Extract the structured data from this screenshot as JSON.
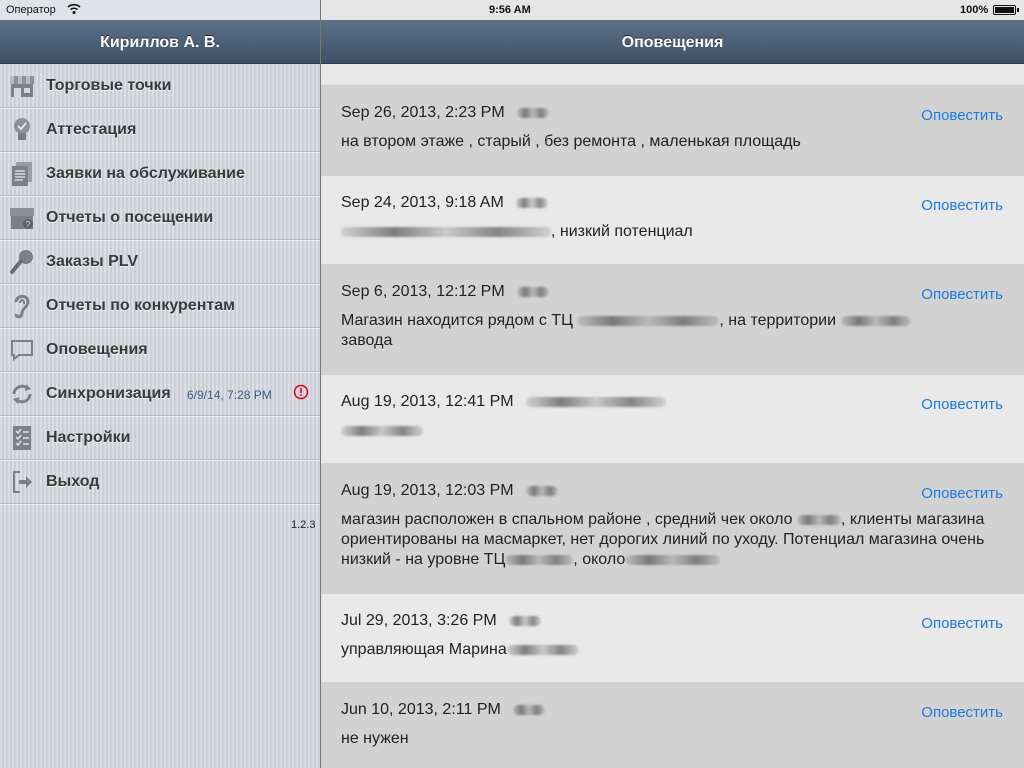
{
  "status_bar": {
    "carrier": "Оператор",
    "time": "9:56 AM",
    "battery": "100%"
  },
  "sidebar": {
    "title": "Кириллов А. В.",
    "items": [
      {
        "label": "Торговые точки",
        "icon": "store-icon"
      },
      {
        "label": "Аттестация",
        "icon": "lightbulb-icon"
      },
      {
        "label": "Заявки на обслуживание",
        "icon": "documents-icon"
      },
      {
        "label": "Отчеты о посещении",
        "icon": "store-report-icon"
      },
      {
        "label": "Заказы PLV",
        "icon": "microphone-icon"
      },
      {
        "label": "Отчеты по конкурентам",
        "icon": "ear-icon"
      },
      {
        "label": "Оповещения",
        "icon": "chat-bubble-icon"
      },
      {
        "label": "Синхронизация",
        "icon": "sync-icon",
        "detail": "6/9/14, 7:28 PM"
      },
      {
        "label": "Настройки",
        "icon": "checklist-icon"
      },
      {
        "label": "Выход",
        "icon": "exit-icon"
      }
    ],
    "version": "1.2.3"
  },
  "main": {
    "title": "Оповещения",
    "notify_label": "Оповестить",
    "notifications": [
      {
        "date": "Sep 26, 2013, 2:23 PM",
        "text": "на втором этаже , старый , без ремонта , маленькая площадь"
      },
      {
        "date": "Sep 24, 2013, 9:18 AM",
        "text": ", низкий потенциал"
      },
      {
        "date": "Sep 6, 2013, 12:12 PM",
        "text_a": "Магазин находится рядом с ТЦ",
        "text_b": ", на территории",
        "text_c": "завода"
      },
      {
        "date": "Aug 19, 2013, 12:41 PM",
        "text": ""
      },
      {
        "date": "Aug 19, 2013, 12:03 PM",
        "text_a": "магазин расположен в спальном районе , средний чек около",
        "text_b": ", клиенты магазина ориентированы на масмаркет, нет дорогих линий по уходу. Потенциал магазина очень низкий - на уровне ТЦ",
        "text_c": ", около"
      },
      {
        "date": "Jul 29, 2013, 3:26 PM",
        "text": "управляющая Марина"
      },
      {
        "date": "Jun 10, 2013, 2:11 PM",
        "text": "не нужен"
      }
    ]
  },
  "colors": {
    "accent": "#1e7ae0",
    "alert": "#d0021b",
    "header_top": "#5d7189",
    "header_bottom": "#3d5068"
  }
}
